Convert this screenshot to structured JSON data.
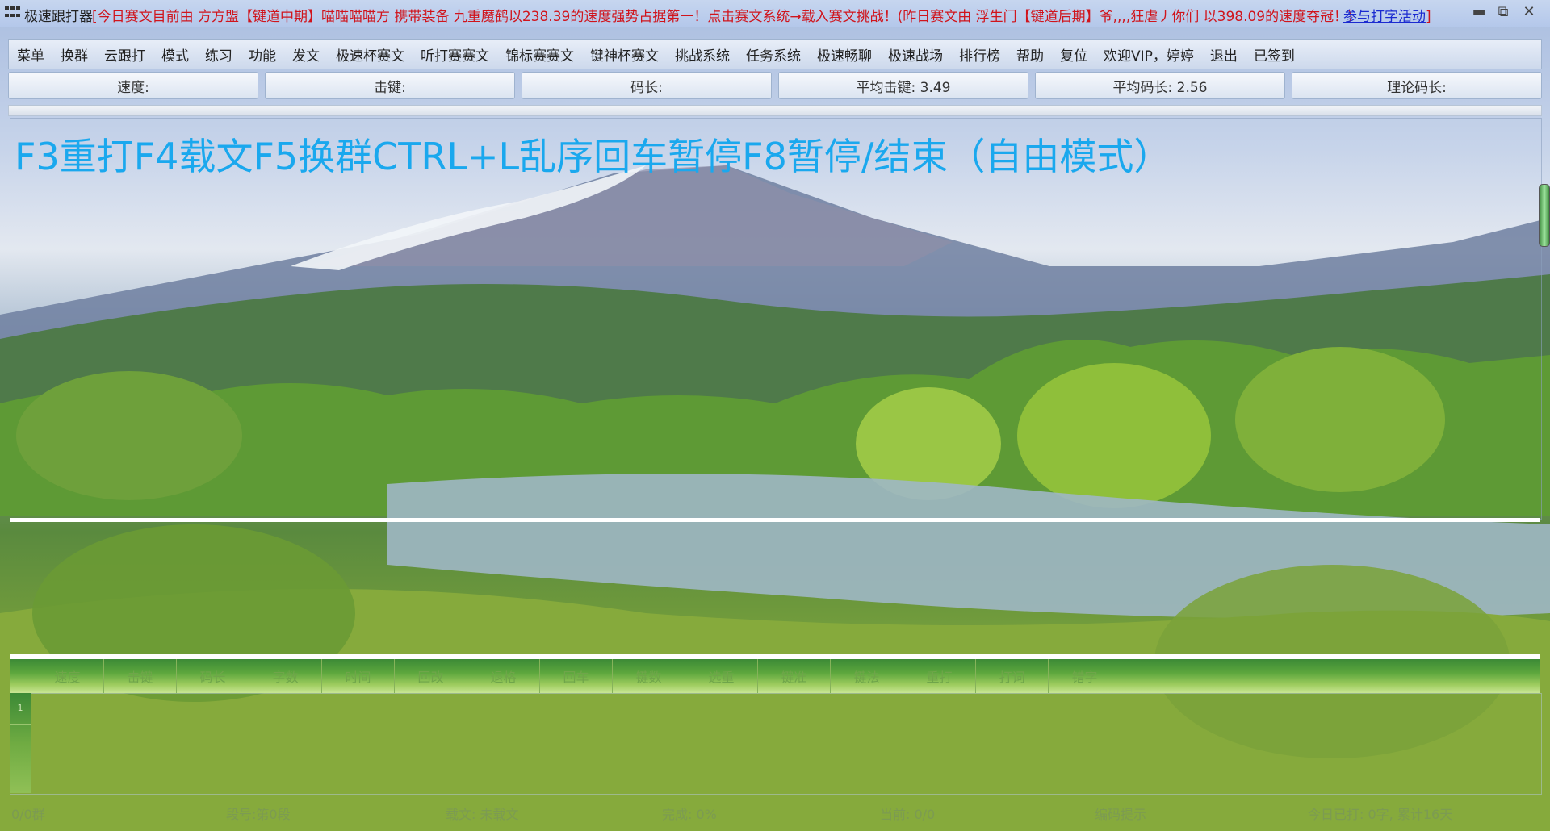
{
  "titlebar": {
    "app_name": "极速跟打器",
    "marquee": "[今日赛文目前由 方方盟【键道中期】喵喵喵喵方 携带装备 九重魔鹤以238.39的速度强势占据第一！点击赛文系统→载入赛文挑战！(昨日赛文由 浮生门【键道后期】爷,,,,狂虐丿你们 以398.09的速度夺冠！)",
    "link_text": "参与打字活动",
    "link_suffix": "]",
    "minimize_glyph": "▬",
    "restore_glyph": "⧉",
    "close_glyph": "✕"
  },
  "menu": {
    "items": [
      {
        "label": "菜单"
      },
      {
        "label": "换群"
      },
      {
        "label": "云跟打"
      },
      {
        "label": "模式"
      },
      {
        "label": "练习"
      },
      {
        "label": "功能"
      },
      {
        "label": "发文"
      },
      {
        "label": "极速杯赛文"
      },
      {
        "label": "听打赛赛文"
      },
      {
        "label": "锦标赛赛文"
      },
      {
        "label": "键神杯赛文"
      },
      {
        "label": "挑战系统"
      },
      {
        "label": "任务系统"
      },
      {
        "label": "极速畅聊"
      },
      {
        "label": "极速战场"
      },
      {
        "label": "排行榜"
      },
      {
        "label": "帮助"
      },
      {
        "label": "复位"
      },
      {
        "label": "欢迎VIP，婷婷"
      },
      {
        "label": "退出"
      },
      {
        "label": "已签到"
      }
    ]
  },
  "stats": {
    "speed": "速度:",
    "keystroke": "击键:",
    "code_length": "码长:",
    "avg_keystroke": "平均击键: 3.49",
    "avg_code_length": "平均码长: 2.56",
    "theory_code_length": "理论码长:"
  },
  "text_area": {
    "hint": "F3重打F4载文F5换群CTRL+L乱序回车暂停F8暂停/结束（自由模式）"
  },
  "grid": {
    "columns": [
      "速度",
      "击键",
      "码长",
      "字数",
      "时间",
      "回改",
      "退格",
      "回车",
      "键数",
      "选重",
      "键准",
      "键法",
      "重打",
      "打词",
      "错字"
    ],
    "row_marker": "1"
  },
  "statusbar": {
    "items": [
      "0/0群",
      "段号:第0段",
      "载文: 未载文",
      "完成: 0%",
      "当前: 0/0",
      "编码提示",
      "今日已打: 0字, 累计16天"
    ]
  },
  "colors": {
    "hint_text": "#1aa8ee",
    "marquee_text": "#d0141c",
    "link_text": "#1a2ad0",
    "grid_header": "#5ca63d"
  }
}
